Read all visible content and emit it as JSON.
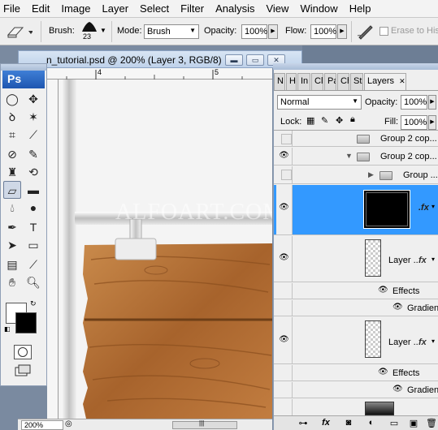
{
  "menubar": {
    "items": [
      "File",
      "Edit",
      "Image",
      "Layer",
      "Select",
      "Filter",
      "Analysis",
      "View",
      "Window",
      "Help"
    ]
  },
  "options": {
    "brush_label": "Brush:",
    "brush_size": "23",
    "mode_label": "Mode:",
    "mode_value": "Brush",
    "opacity_label": "Opacity:",
    "opacity_value": "100%",
    "flow_label": "Flow:",
    "flow_value": "100%",
    "erase_history_label": "Erase to Histo"
  },
  "document": {
    "title": "n_tutorial.psd @ 200% (Layer 3, RGB/8)",
    "ruler_marks": [
      "4",
      "5"
    ],
    "zoom": "200%",
    "watermark": "ALFOART.COM"
  },
  "tools": {
    "logo": "Ps"
  },
  "colors": {
    "foreground": "#ffffff",
    "background": "#000000",
    "selection": "#3399ff",
    "wood": "#b8743a"
  },
  "layers": {
    "tabs": [
      "N",
      "H",
      "In",
      "Cl",
      "Pa",
      "Ch",
      "St"
    ],
    "active_tab": "Layers",
    "blend_mode": "Normal",
    "opacity_label": "Opacity:",
    "opacity_value": "100%",
    "lock_label": "Lock:",
    "fill_label": "Fill:",
    "fill_value": "100%",
    "rows": [
      {
        "name": "Group 2 cop..."
      },
      {
        "name": "Group 2 cop..."
      },
      {
        "name": "Group ..."
      },
      {
        "name": "Layer ..."
      },
      {
        "name": "Effects"
      },
      {
        "name": "Gradien..."
      },
      {
        "name": "Layer ..."
      },
      {
        "name": "Effects"
      },
      {
        "name": "Gradien..."
      }
    ]
  }
}
